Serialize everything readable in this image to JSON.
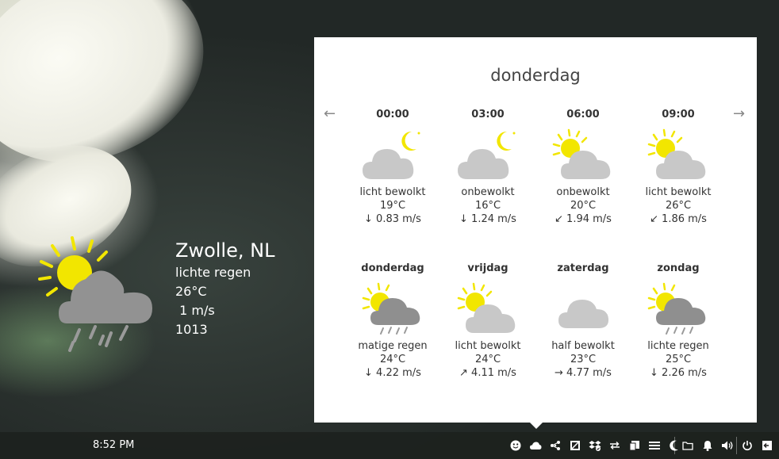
{
  "widget": {
    "city": "Zwolle, NL",
    "condition": "lichte regen",
    "temperature": "26°C",
    "wind": " 1 m/s",
    "pressure": "1013",
    "icon": "sun-cloud-rain-icon"
  },
  "popup": {
    "title": "donderdag",
    "prev_arrow": "←",
    "next_arrow": "→",
    "hourly": [
      {
        "time": "00:00",
        "icon": "moon-cloud-icon",
        "condition": "licht bewolkt",
        "temp": "19°C",
        "wind": "↓ 0.83 m/s"
      },
      {
        "time": "03:00",
        "icon": "moon-cloud-icon",
        "condition": "onbewolkt",
        "temp": "16°C",
        "wind": "↓ 1.24 m/s"
      },
      {
        "time": "06:00",
        "icon": "sun-cloud-icon",
        "condition": "onbewolkt",
        "temp": "20°C",
        "wind": "↙ 1.94 m/s"
      },
      {
        "time": "09:00",
        "icon": "sun-cloud-icon",
        "condition": "licht bewolkt",
        "temp": "26°C",
        "wind": "↙ 1.86 m/s"
      }
    ],
    "daily": [
      {
        "day": "donderdag",
        "icon": "sun-cloud-rain-icon",
        "condition": "matige regen",
        "temp": "24°C",
        "wind": "↓ 4.22 m/s"
      },
      {
        "day": "vrijdag",
        "icon": "sun-cloud-icon",
        "condition": "licht bewolkt",
        "temp": "24°C",
        "wind": "↗ 4.11 m/s"
      },
      {
        "day": "zaterdag",
        "icon": "cloud-icon",
        "condition": "half bewolkt",
        "temp": "23°C",
        "wind": "→ 4.77 m/s"
      },
      {
        "day": "zondag",
        "icon": "sun-cloud-rain-icon",
        "condition": "lichte regen",
        "temp": "25°C",
        "wind": "↓ 2.26 m/s"
      }
    ]
  },
  "taskbar": {
    "clock": "8:52 PM",
    "tray_icons": [
      "emoji-icon",
      "weather-cloud-icon",
      "share-icon",
      "screenshot-icon",
      "dropbox-icon",
      "sync-icon",
      "notes-icon",
      "list-icon",
      "night-mode-icon",
      "folder-icon",
      "notification-bell-icon",
      "volume-icon",
      "power-icon",
      "exit-icon"
    ]
  },
  "colors": {
    "sun": "#f2e600",
    "cloud_light": "#c8c8c8",
    "cloud_dark": "#8f8f8f",
    "rain": "#9a9a9a"
  }
}
